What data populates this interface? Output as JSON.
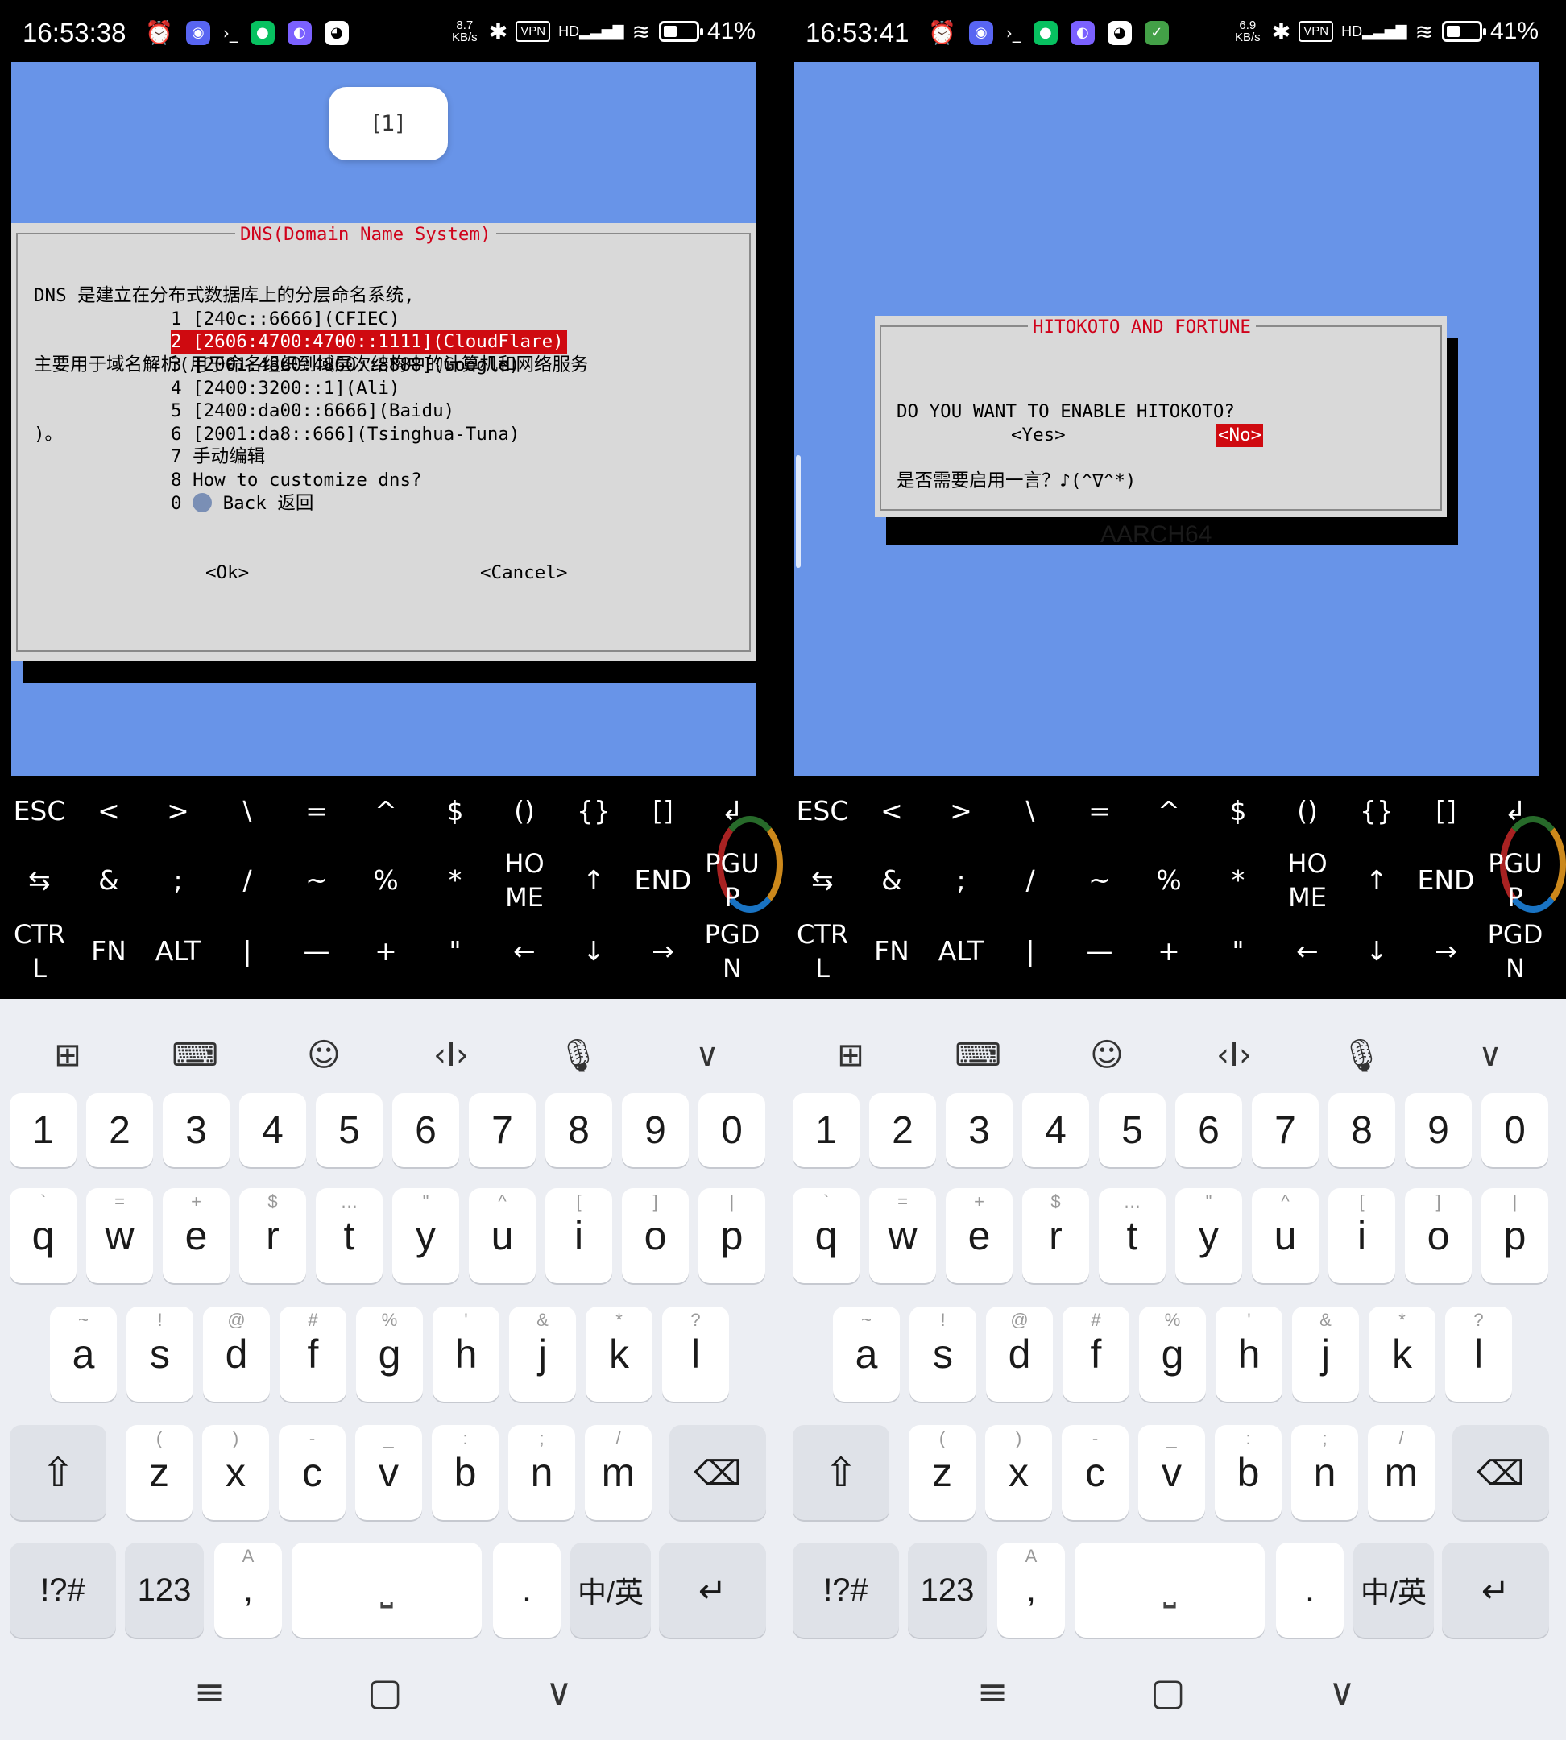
{
  "status_left": {
    "time": "16:53:38",
    "net_speed_value": "8.7",
    "net_speed_unit": "KB/s",
    "vpn": "VPN",
    "hd": "HD",
    "battery": "41%",
    "battery_fill": 0.41
  },
  "status_right": {
    "time": "16:53:41",
    "net_speed_value": "6.9",
    "net_speed_unit": "KB/s",
    "vpn": "VPN",
    "hd": "HD",
    "battery": "41%",
    "battery_fill": 0.41
  },
  "dns_dialog": {
    "toast": "[1]",
    "title": "DNS(Domain Name System)",
    "description_lines": [
      "DNS 是建立在分布式数据库上的分层命名系统,",
      "主要用于域名解析(用于命名组织到域层次结构中的计算机和网络服务",
      ")。"
    ],
    "items": [
      "1 [240c::6666](CFIEC)",
      "2 [2606:4700:4700::1111](CloudFlare)",
      "3 [2001:4860:4860::8888](Google)",
      "4 [2400:3200::1](Ali)",
      "5 [2400:da00::6666](Baidu)",
      "6 [2001:da8::666](Tsinghua-Tuna)",
      "7 手动编辑",
      "8 How to customize dns?",
      "0 ",
      " Back 返回"
    ],
    "selected_index": 1,
    "ok": "<Ok>",
    "cancel": "<Cancel>"
  },
  "hitokoto_dialog": {
    "title": "HITOKOTO AND FORTUNE",
    "line1": "DO YOU WANT TO ENABLE HITOKOTO?",
    "line2": "是否需要启用一言？♪(^∇^*)",
    "yes": "<Yes>",
    "no": "<No>",
    "watermark": "AARCH64"
  },
  "extra_keys": {
    "row1": [
      "ESC",
      "<",
      ">",
      "\\",
      "=",
      "^",
      "$",
      "()",
      "{}",
      "[]",
      "↲"
    ],
    "row2": [
      "⇆",
      "&",
      ";",
      "/",
      "~",
      "%",
      "*",
      "HO\nME",
      "↑",
      "END",
      "PGU\nP"
    ],
    "row3": [
      "CTR\nL",
      "FN",
      "ALT",
      "|",
      "—",
      "+",
      "\"",
      "←",
      "↓",
      "→",
      "PGD\nN"
    ]
  },
  "keyboard": {
    "toolbar_icons": [
      "apps-icon",
      "keyboard-grid-icon",
      "emoji-icon",
      "cursor-icon",
      "mic-icon",
      "collapse-icon"
    ],
    "numbers": [
      "1",
      "2",
      "3",
      "4",
      "5",
      "6",
      "7",
      "8",
      "9",
      "0"
    ],
    "row_q": [
      {
        "k": "q",
        "s": "`"
      },
      {
        "k": "w",
        "s": "="
      },
      {
        "k": "e",
        "s": "+"
      },
      {
        "k": "r",
        "s": "$"
      },
      {
        "k": "t",
        "s": "…"
      },
      {
        "k": "y",
        "s": "\""
      },
      {
        "k": "u",
        "s": "^"
      },
      {
        "k": "i",
        "s": "["
      },
      {
        "k": "o",
        "s": "]"
      },
      {
        "k": "p",
        "s": "|"
      }
    ],
    "row_a": [
      {
        "k": "a",
        "s": "~"
      },
      {
        "k": "s",
        "s": "!"
      },
      {
        "k": "d",
        "s": "@"
      },
      {
        "k": "f",
        "s": "#"
      },
      {
        "k": "g",
        "s": "%"
      },
      {
        "k": "h",
        "s": "'"
      },
      {
        "k": "j",
        "s": "&"
      },
      {
        "k": "k",
        "s": "*"
      },
      {
        "k": "l",
        "s": "?"
      }
    ],
    "row_z": [
      {
        "k": "z",
        "s": "("
      },
      {
        "k": "x",
        "s": ")"
      },
      {
        "k": "c",
        "s": "-"
      },
      {
        "k": "v",
        "s": "_"
      },
      {
        "k": "b",
        "s": ":"
      },
      {
        "k": "n",
        "s": ";"
      },
      {
        "k": "m",
        "s": "/"
      }
    ],
    "symbols": "!?#",
    "num_toggle": "123",
    "comma": ",",
    "comma_sub": "A",
    "period": ".",
    "lang": "中/英",
    "shift_icon": "shift-icon",
    "backspace_icon": "backspace-icon",
    "enter_icon": "enter-icon"
  },
  "nav": {
    "menu": "≡",
    "home": "▢",
    "back": "∨"
  }
}
